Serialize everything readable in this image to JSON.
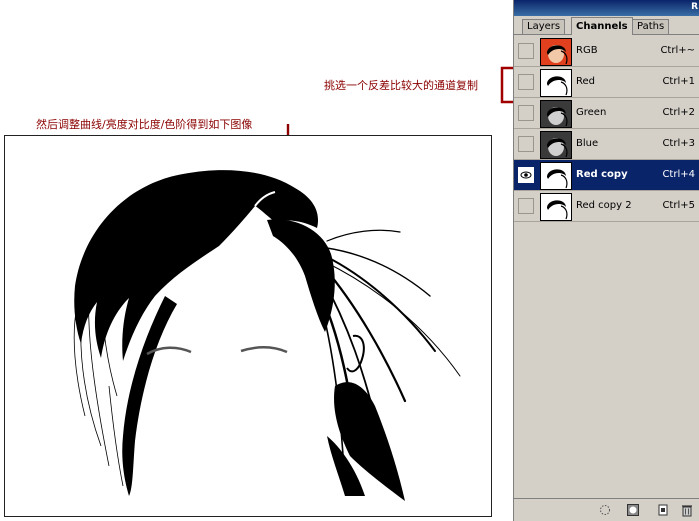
{
  "annotations": {
    "left": "然后调整曲线/亮度对比度/色阶得到如下图像",
    "right": "挑选一个反差比较大的通道复制"
  },
  "panel": {
    "titlebar_glyph": "R",
    "tabs": [
      {
        "label": "Layers",
        "active": false
      },
      {
        "label": "Channels",
        "active": true
      },
      {
        "label": "Paths",
        "active": false
      }
    ],
    "channels": [
      {
        "name": "RGB",
        "shortcut": "Ctrl+~",
        "visible": false,
        "selected": false,
        "thumb": "color"
      },
      {
        "name": "Red",
        "shortcut": "Ctrl+1",
        "visible": false,
        "selected": false,
        "thumb": "light"
      },
      {
        "name": "Green",
        "shortcut": "Ctrl+2",
        "visible": false,
        "selected": false,
        "thumb": "dark"
      },
      {
        "name": "Blue",
        "shortcut": "Ctrl+3",
        "visible": false,
        "selected": false,
        "thumb": "dark"
      },
      {
        "name": "Red copy",
        "shortcut": "Ctrl+4",
        "visible": true,
        "selected": true,
        "thumb": "light"
      },
      {
        "name": "Red copy 2",
        "shortcut": "Ctrl+5",
        "visible": false,
        "selected": false,
        "thumb": "light"
      }
    ],
    "bottom_icons": [
      "load-selection-icon",
      "save-mask-icon",
      "new-channel-icon",
      "trash-icon"
    ]
  },
  "colors": {
    "annotation": "#8b0000",
    "panel_bg": "#d4d0c8",
    "selection": "#0a246a",
    "highlight_box": "#a00000"
  }
}
